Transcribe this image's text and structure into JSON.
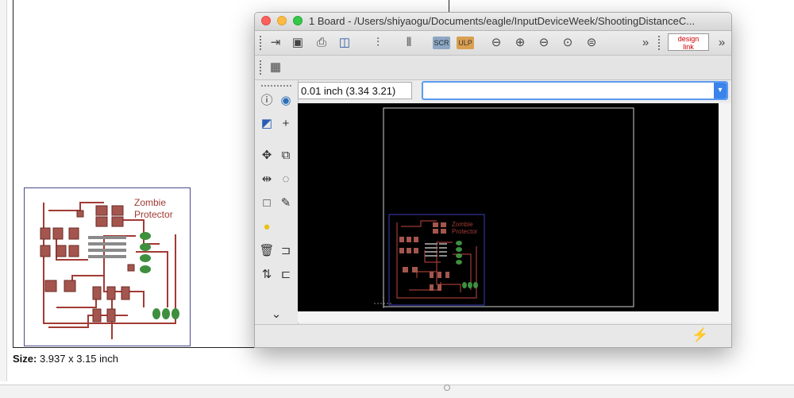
{
  "background": {
    "size_label": "Size:",
    "size_value": "3.937 x 3.15 inch",
    "board_text_line1": "Zombie",
    "board_text_line2": "Protector"
  },
  "window": {
    "title": "1 Board - /Users/shiyaogu/Documents/eagle/InputDeviceWeek/ShootingDistanceC...",
    "toolbar": {
      "icons": [
        "open-icon",
        "save-icon",
        "print-icon",
        "cam-icon",
        "script-icon",
        "layers-icon",
        "scr-icon",
        "ulp-icon",
        "zoom-fit-icon",
        "zoom-in-icon",
        "zoom-out-icon",
        "zoom-select-icon",
        "zoom-redraw-icon",
        "more-icon"
      ],
      "scr_label": "SCR",
      "ulp_label": "ULP",
      "design_link_line1": "design",
      "design_link_line2": "link"
    },
    "coord_display": "0.01 inch (3.34 3.21)",
    "command_input": {
      "value": "",
      "placeholder": ""
    },
    "canvas": {
      "board_text_line1": "Zombie",
      "board_text_line2": "Protector"
    }
  },
  "colors": {
    "canvas_bg": "#000000",
    "trace": "#a13b34",
    "outline": "#3c3cbb",
    "pad_green": "#3e8f3e",
    "accent_blue": "#3a83ea"
  }
}
